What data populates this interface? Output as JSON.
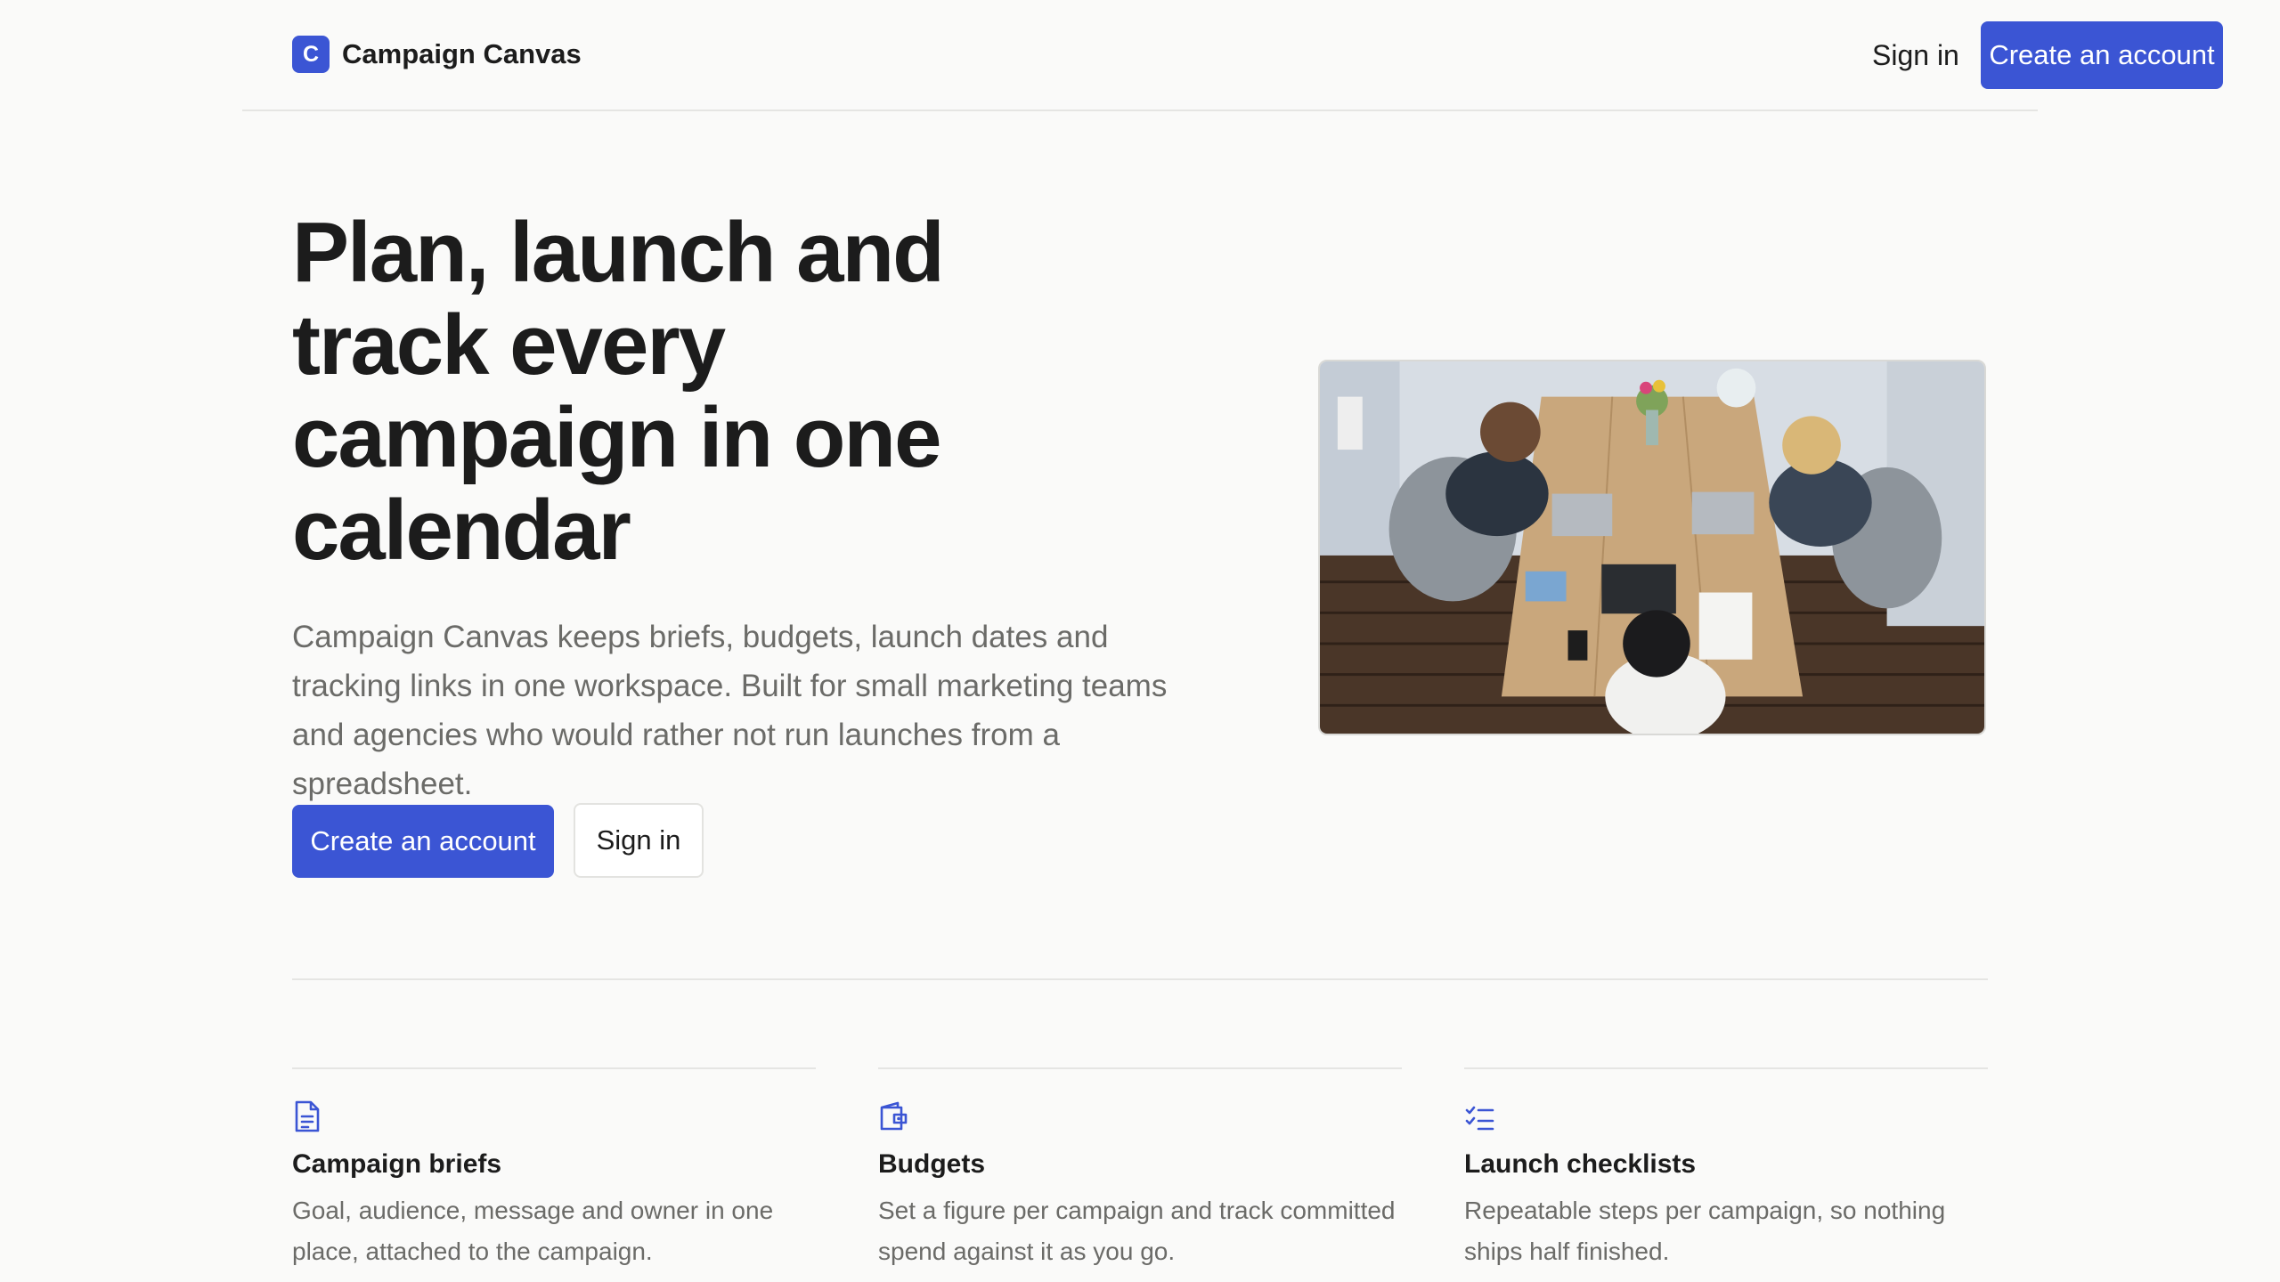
{
  "header": {
    "logo_letter": "C",
    "brand_name": "Campaign Canvas",
    "signin_label": "Sign in",
    "cta_label": "Create an account"
  },
  "hero": {
    "title": "Plan, launch and track every campaign in one calendar",
    "subtitle": "Campaign Canvas keeps briefs, budgets, launch dates and tracking links in one workspace. Built for small marketing teams and agencies who would rather not run launches from a spreadsheet.",
    "primary_cta": "Create an account",
    "secondary_cta": "Sign in"
  },
  "features": [
    {
      "icon": "document-icon",
      "title": "Campaign briefs",
      "description": "Goal, audience, message and owner in one place, attached to the campaign."
    },
    {
      "icon": "wallet-icon",
      "title": "Budgets",
      "description": "Set a figure per campaign and track committed spend against it as you go."
    },
    {
      "icon": "checklist-icon",
      "title": "Launch checklists",
      "description": "Repeatable steps per campaign, so nothing ships half finished."
    }
  ],
  "colors": {
    "accent": "#3b55d4",
    "background": "#fafaf9",
    "text": "#1c1c1c",
    "muted_text": "#6b6b68"
  }
}
